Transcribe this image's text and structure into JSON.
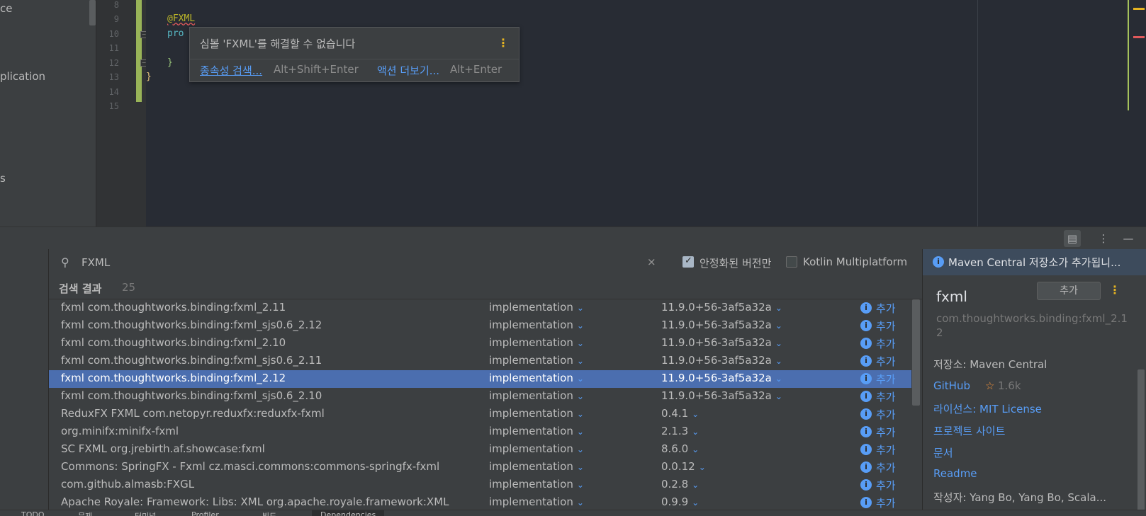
{
  "project_panel": {
    "fragments": [
      "ce",
      "plication",
      "s"
    ]
  },
  "editor": {
    "line_numbers": [
      "8",
      "9",
      "10",
      "11",
      "12",
      "13",
      "14",
      "15"
    ],
    "code_annotation": "@FXML",
    "code_keyword": "pro",
    "code_brace_close": "}",
    "code_class_close": "}"
  },
  "quick_popup": {
    "title": "심볼 'FXML'를 해결할 수 없습니다",
    "primary_link": "종속성 검색...",
    "primary_shortcut": "Alt+Shift+Enter",
    "more_link": "액션 더보기...",
    "more_shortcut": "Alt+Enter"
  },
  "search": {
    "query": "FXML",
    "stable_only_label": "안정화된 버전만",
    "stable_only_checked": true,
    "kmp_label": "Kotlin Multiplatform",
    "kmp_checked": false,
    "results_label": "검색 결과",
    "results_count": "25",
    "add_label": "추가",
    "rows": [
      {
        "name": "fxml  com.thoughtworks.binding:fxml_2.11",
        "scope": "implementation",
        "version": "11.9.0+56-3af5a32a",
        "selected": false
      },
      {
        "name": "fxml  com.thoughtworks.binding:fxml_sjs0.6_2.12",
        "scope": "implementation",
        "version": "11.9.0+56-3af5a32a",
        "selected": false
      },
      {
        "name": "fxml  com.thoughtworks.binding:fxml_2.10",
        "scope": "implementation",
        "version": "11.9.0+56-3af5a32a",
        "selected": false
      },
      {
        "name": "fxml  com.thoughtworks.binding:fxml_sjs0.6_2.11",
        "scope": "implementation",
        "version": "11.9.0+56-3af5a32a",
        "selected": false
      },
      {
        "name": "fxml  com.thoughtworks.binding:fxml_2.12",
        "scope": "implementation",
        "version": "11.9.0+56-3af5a32a",
        "selected": true
      },
      {
        "name": "fxml  com.thoughtworks.binding:fxml_sjs0.6_2.10",
        "scope": "implementation",
        "version": "11.9.0+56-3af5a32a",
        "selected": false
      },
      {
        "name": "ReduxFX FXML  com.netopyr.reduxfx:reduxfx-fxml",
        "scope": "implementation",
        "version": "0.4.1",
        "selected": false
      },
      {
        "name": "org.minifx:minifx-fxml",
        "scope": "implementation",
        "version": "2.1.3",
        "selected": false
      },
      {
        "name": "SC FXML  org.jrebirth.af.showcase:fxml",
        "scope": "implementation",
        "version": "8.6.0",
        "selected": false
      },
      {
        "name": "Commons: SpringFX - Fxml  cz.masci.commons:commons-springfx-fxml",
        "scope": "implementation",
        "version": "0.0.12",
        "selected": false
      },
      {
        "name": "com.github.almasb:FXGL",
        "scope": "implementation",
        "version": "0.2.8",
        "selected": false
      },
      {
        "name": "Apache Royale: Framework: Libs: XML  org.apache.royale.framework:XML",
        "scope": "implementation",
        "version": "0.9.9",
        "selected": false
      }
    ]
  },
  "details": {
    "banner_text": "Maven Central 저장소가 추가됩니...",
    "name": "fxml",
    "add_button": "추가",
    "coordinate": "com.thoughtworks.binding:fxml_2.12",
    "repository": "저장소: Maven Central",
    "github_label": "GitHub",
    "github_stars": "1.6k",
    "license": "라이선스: MIT License",
    "project_site": "프로젝트 사이트",
    "docs": "문서",
    "readme": "Readme",
    "author_partial": "작성자: Yang Bo, Yang Bo, Scala..."
  },
  "bottom_tabs": [
    "TODO",
    "문제",
    "터미널",
    "Profiler",
    "빌드",
    "Dependencies"
  ],
  "colors": {
    "accent": "#589df6",
    "selection": "#4b6eaf",
    "warning": "#e6b422",
    "error": "#e0595b"
  }
}
